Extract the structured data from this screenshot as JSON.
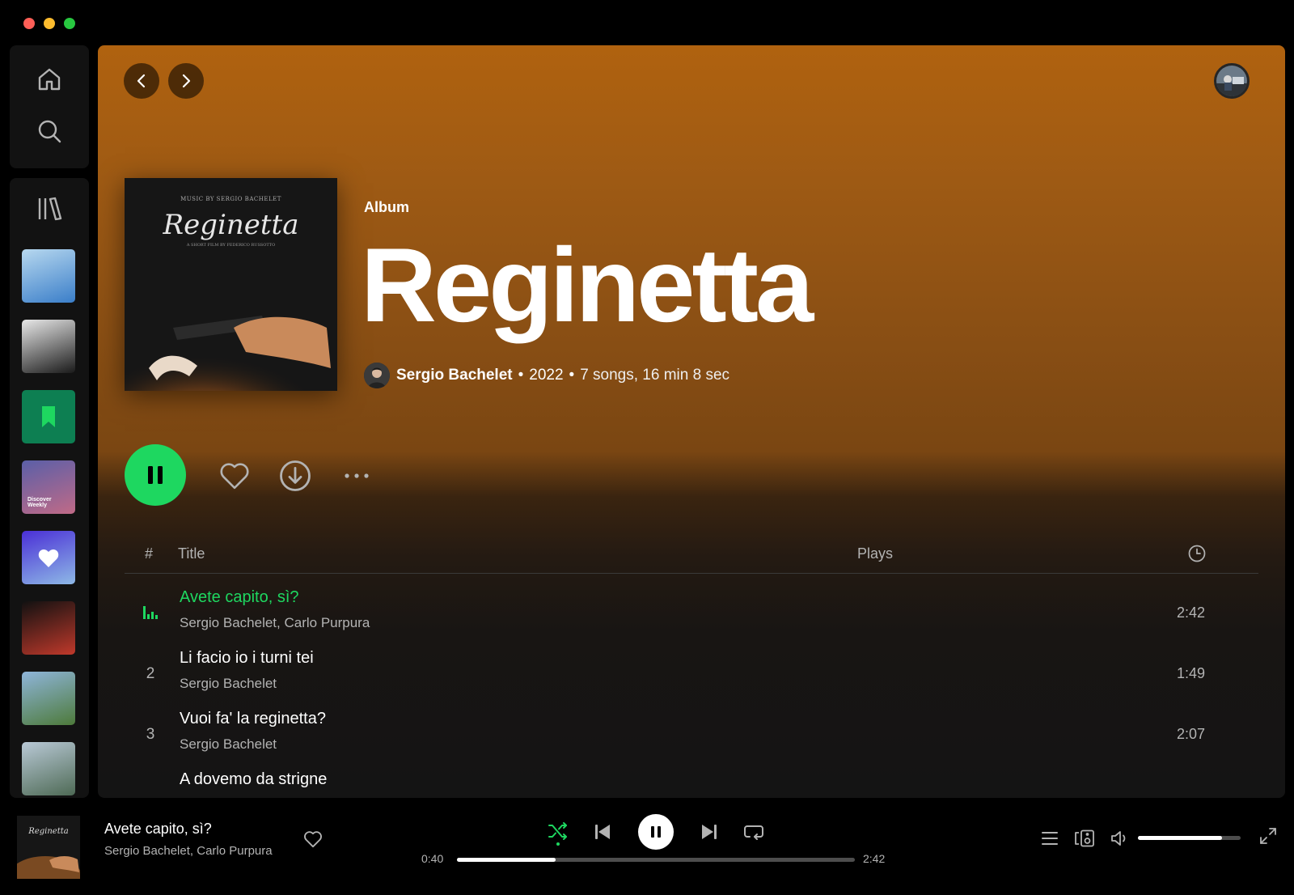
{
  "album": {
    "type_label": "Album",
    "title": "Reginetta",
    "artist": "Sergio Bachelet",
    "year": "2022",
    "summary": "7 songs, 16 min 8 sec",
    "separator": "•",
    "cover_small_text": "MUSIC BY SERGIO BACHELET",
    "cover_title": "Reginetta",
    "cover_sub_text": "A SHORT FILM BY FEDERICO RUSSOTTO"
  },
  "table": {
    "headers": {
      "number": "#",
      "title": "Title",
      "plays": "Plays"
    },
    "tracks": [
      {
        "number": "",
        "title": "Avete capito, sì?",
        "artists": "Sergio Bachelet, Carlo Purpura",
        "duration": "2:42",
        "playing": true
      },
      {
        "number": "2",
        "title": "Li facio io i turni tei",
        "artists": "Sergio Bachelet",
        "duration": "1:49",
        "playing": false
      },
      {
        "number": "3",
        "title": "Vuoi fa' la reginetta?",
        "artists": "Sergio Bachelet",
        "duration": "2:07",
        "playing": false
      },
      {
        "number": "",
        "title": "A dovemo da strigne",
        "artists": "",
        "duration": "",
        "playing": false
      }
    ]
  },
  "library": {
    "items": [
      {
        "name": "playlist-art-1",
        "colors": [
          "#b7d8ef",
          "#3a7ec9"
        ]
      },
      {
        "name": "playlist-art-2",
        "colors": [
          "#e8e8e8",
          "#1a1a1a"
        ]
      },
      {
        "name": "saved-episodes",
        "colors": [
          "#0d7f52",
          "#0d7f52"
        ]
      },
      {
        "name": "discover-weekly",
        "colors": [
          "#5a5fa8",
          "#c06a87"
        ],
        "label": "Discover Weekly"
      },
      {
        "name": "liked-songs",
        "colors": [
          "#4a2fd6",
          "#8eb9e6"
        ]
      },
      {
        "name": "playlist-art-6",
        "colors": [
          "#111111",
          "#c0392b"
        ]
      },
      {
        "name": "playlist-art-7",
        "colors": [
          "#8fb5da",
          "#4d7a3a"
        ]
      },
      {
        "name": "playlist-art-8",
        "colors": [
          "#b9c9d6",
          "#4e6a55"
        ]
      }
    ]
  },
  "player": {
    "title": "Avete capito, sì?",
    "artist": "Sergio Bachelet, Carlo Purpura",
    "elapsed": "0:40",
    "duration": "2:42",
    "progress_fraction": 0.247,
    "volume_fraction": 0.82,
    "cover_title": "Reginetta"
  },
  "colors": {
    "accent": "#1ed760",
    "header_top": "#b0620f",
    "background": "#121212"
  }
}
